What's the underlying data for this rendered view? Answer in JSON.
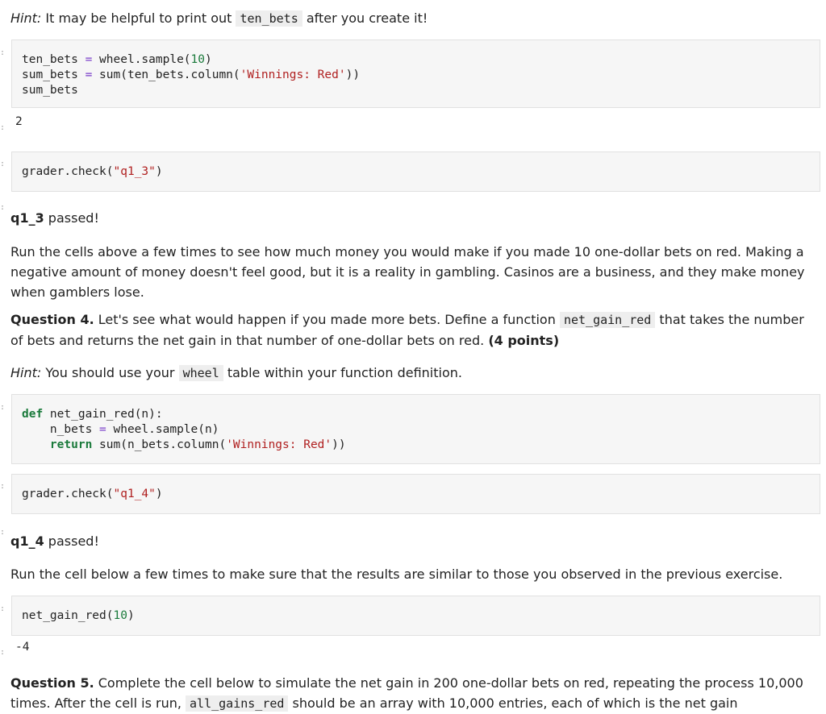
{
  "hint1": {
    "label": "Hint:",
    "text_before": " It may be helpful to print out ",
    "code": "ten_bets",
    "text_after": " after you create it!"
  },
  "cell1": {
    "line1_var": "ten_bets",
    "line1_rest": "wheel.sample(",
    "line1_num": "10",
    "line1_close": ")",
    "line2_var": "sum_bets",
    "line2_rest": "sum(ten_bets.column(",
    "line2_str": "'Winnings: Red'",
    "line2_close": "))",
    "line3": "sum_bets",
    "output": "2"
  },
  "cell2": {
    "pre": "grader.check(",
    "str": "\"q1_3\"",
    "post": ")"
  },
  "result_q1_3": {
    "bold": "q1_3",
    "text": " passed!"
  },
  "para_q3": "Run the cells above a few times to see how much money you would make if you made 10 one-dollar bets on red. Making a negative amount of money doesn't feel good, but it is a reality in gambling. Casinos are a business, and they make money when gamblers lose.",
  "q4": {
    "label": "Question 4.",
    "text1": " Let's see what would happen if you made more bets. Define a function ",
    "code": "net_gain_red",
    "text2": " that takes the number of bets and returns the net gain in that number of one-dollar bets on red. ",
    "points": "(4 points)"
  },
  "hint2": {
    "label": "Hint:",
    "text_before": " You should use your ",
    "code": "wheel",
    "text_after": " table within your function definition."
  },
  "cell3": {
    "def_kw": "def",
    "def_name": " net_gain_red(n):",
    "line2_a": "    n_bets ",
    "line2_eq": "=",
    "line2_b": " wheel.sample(n)",
    "ret_kw": "return",
    "ret_a": " sum(n_bets.column(",
    "ret_str": "'Winnings: Red'",
    "ret_b": "))"
  },
  "cell4": {
    "pre": "grader.check(",
    "str": "\"q1_4\"",
    "post": ")"
  },
  "result_q1_4": {
    "bold": "q1_4",
    "text": " passed!"
  },
  "para_q4": "Run the cell below a few times to make sure that the results are similar to those you observed in the previous exercise.",
  "cell5": {
    "pre": "net_gain_red(",
    "num": "10",
    "post": ")",
    "output": "-4"
  },
  "q5": {
    "label": "Question 5.",
    "text1": " Complete the cell below to simulate the net gain in 200 one-dollar bets on red, repeating the process 10,000 times. After the cell is run, ",
    "code": "all_gains_red",
    "text2": " should be an array with 10,000 entries, each of which is the net gain"
  }
}
